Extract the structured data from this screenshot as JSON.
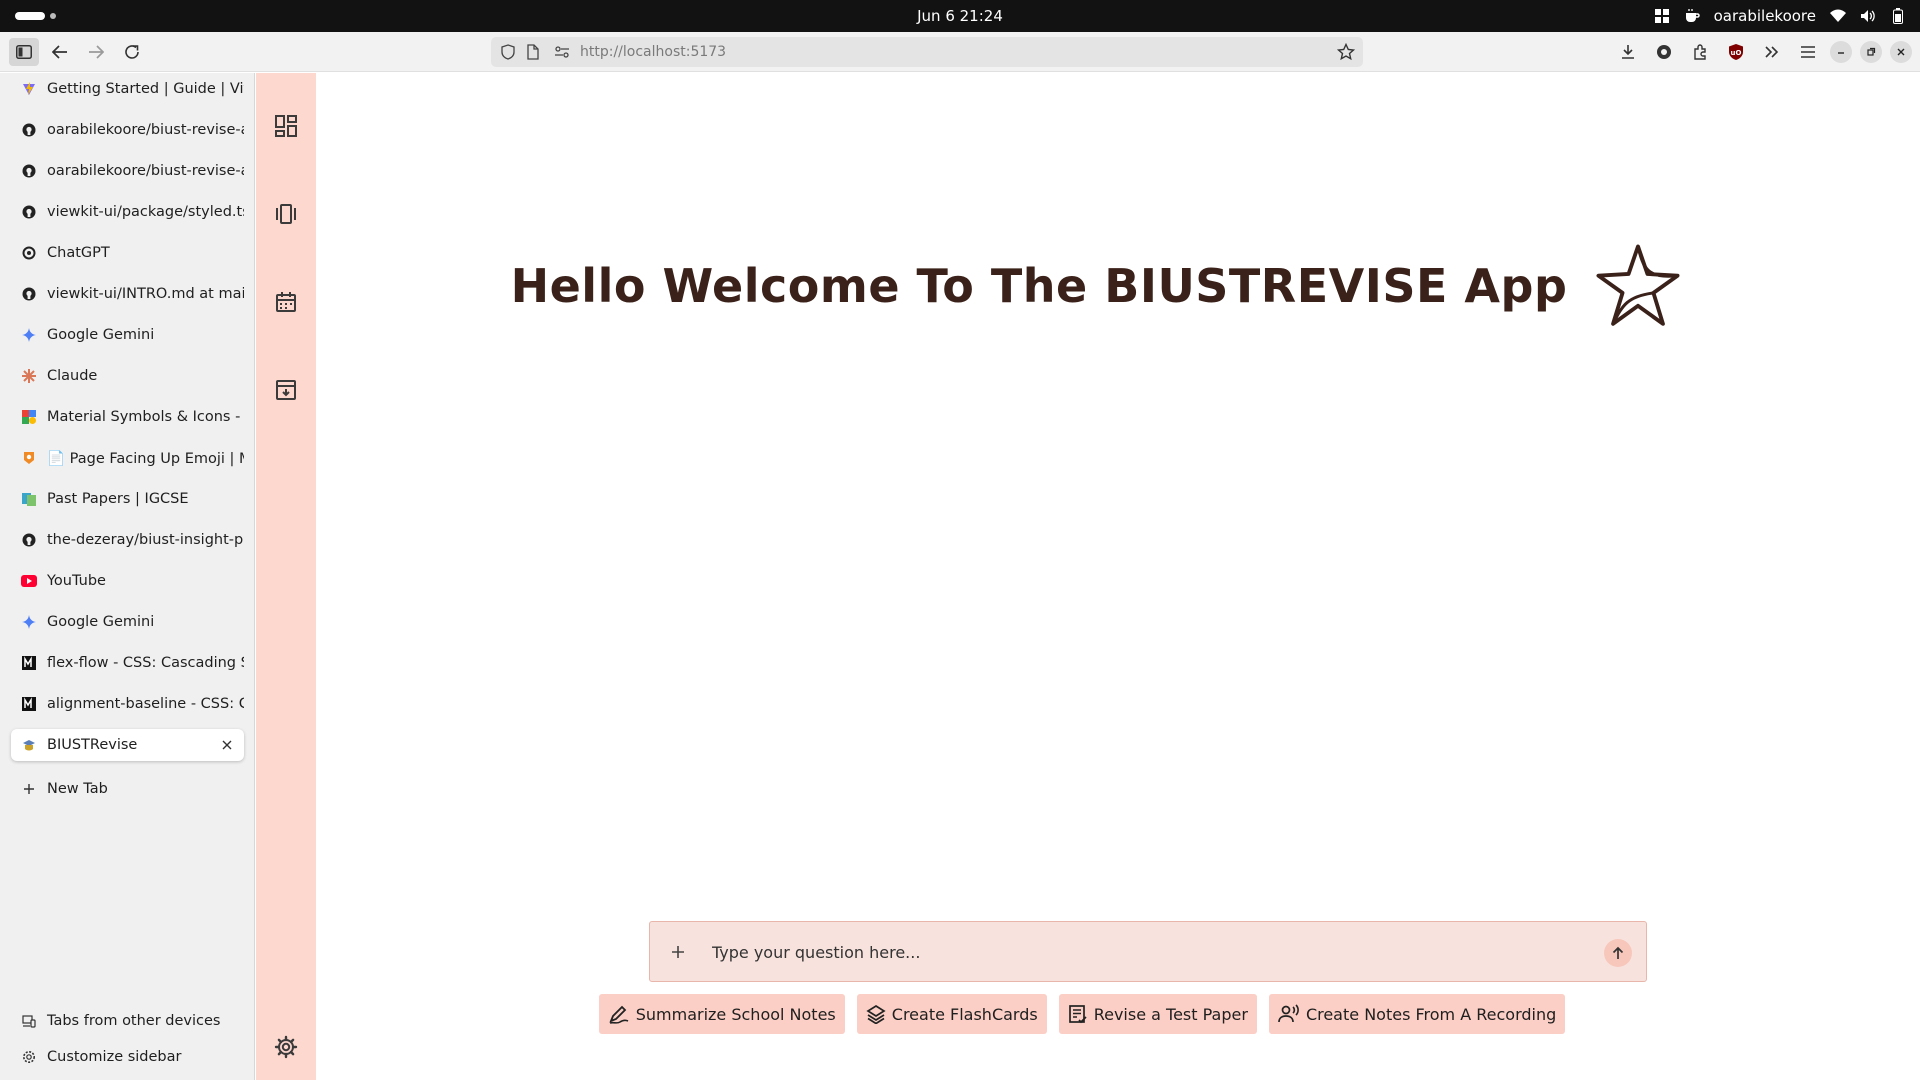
{
  "os": {
    "clock": "Jun 6  21:24",
    "user": "oarabilekoore"
  },
  "browser": {
    "url": "http://localhost:5173"
  },
  "tabs": [
    {
      "title": "Getting Started | Guide | Vite",
      "favicon": "vite-icon",
      "color": "#f5b800"
    },
    {
      "title": "oarabilekoore/biust-revise-app",
      "favicon": "github-icon",
      "color": "#222222"
    },
    {
      "title": "oarabilekoore/biust-revise-app",
      "favicon": "github-icon",
      "color": "#222222"
    },
    {
      "title": "viewkit-ui/package/styled.ts at main",
      "favicon": "github-icon",
      "color": "#222222"
    },
    {
      "title": "ChatGPT",
      "favicon": "chatgpt-icon",
      "color": "#222222"
    },
    {
      "title": "viewkit-ui/INTRO.md at main",
      "favicon": "github-icon",
      "color": "#222222"
    },
    {
      "title": "Google Gemini",
      "favicon": "gemini-icon",
      "color": "#4e7ff5"
    },
    {
      "title": "Claude",
      "favicon": "claude-icon",
      "color": "#d97757"
    },
    {
      "title": "Material Symbols & Icons - Google Fonts",
      "favicon": "google-fonts-icon",
      "color": "#4285f4"
    },
    {
      "title": "📄 Page Facing Up Emoji | Meaning",
      "favicon": "emojipedia-icon",
      "color": "#f08a24"
    },
    {
      "title": "Past Papers | IGCSE",
      "favicon": "pastpapers-icon",
      "color": "#3aa5c8"
    },
    {
      "title": "the-dezeray/biust-insight-project",
      "favicon": "github-icon",
      "color": "#222222"
    },
    {
      "title": "YouTube",
      "favicon": "youtube-icon",
      "color": "#ff0033"
    },
    {
      "title": "Google Gemini",
      "favicon": "gemini-icon",
      "color": "#4e7ff5"
    },
    {
      "title": "flex-flow - CSS: Cascading Style Sheets",
      "favicon": "mdn-icon",
      "color": "#111111"
    },
    {
      "title": "alignment-baseline - CSS: Cascading Style Sheets",
      "favicon": "mdn-icon",
      "color": "#111111"
    },
    {
      "title": "BIUSTRevise",
      "favicon": "biustrevise-icon",
      "color": "#5b7fb5",
      "active": true
    }
  ],
  "sidebar": {
    "new_tab": "New Tab",
    "tabs_other_devices": "Tabs from other devices",
    "customize": "Customize sidebar"
  },
  "app": {
    "welcome_title": "Hello Welcome To The BIUSTREVISE App",
    "chat_placeholder": "Type your question here...",
    "actions": [
      {
        "label": "Summarize School Notes",
        "icon": "ink-pen-icon"
      },
      {
        "label": "Create FlashCards",
        "icon": "layers-icon"
      },
      {
        "label": "Revise a Test Paper",
        "icon": "test-paper-icon"
      },
      {
        "label": "Create Notes From A Recording",
        "icon": "voice-recording-icon"
      }
    ],
    "rail": [
      "dashboard-icon",
      "carousel-icon",
      "calendar-icon",
      "archive-download-icon",
      "settings-icon"
    ],
    "colors": {
      "rail_bg": "#fdd8cf",
      "chip_bg": "#fbcfc5",
      "chat_bg": "#f8e2dd",
      "title": "#3a2119"
    }
  }
}
